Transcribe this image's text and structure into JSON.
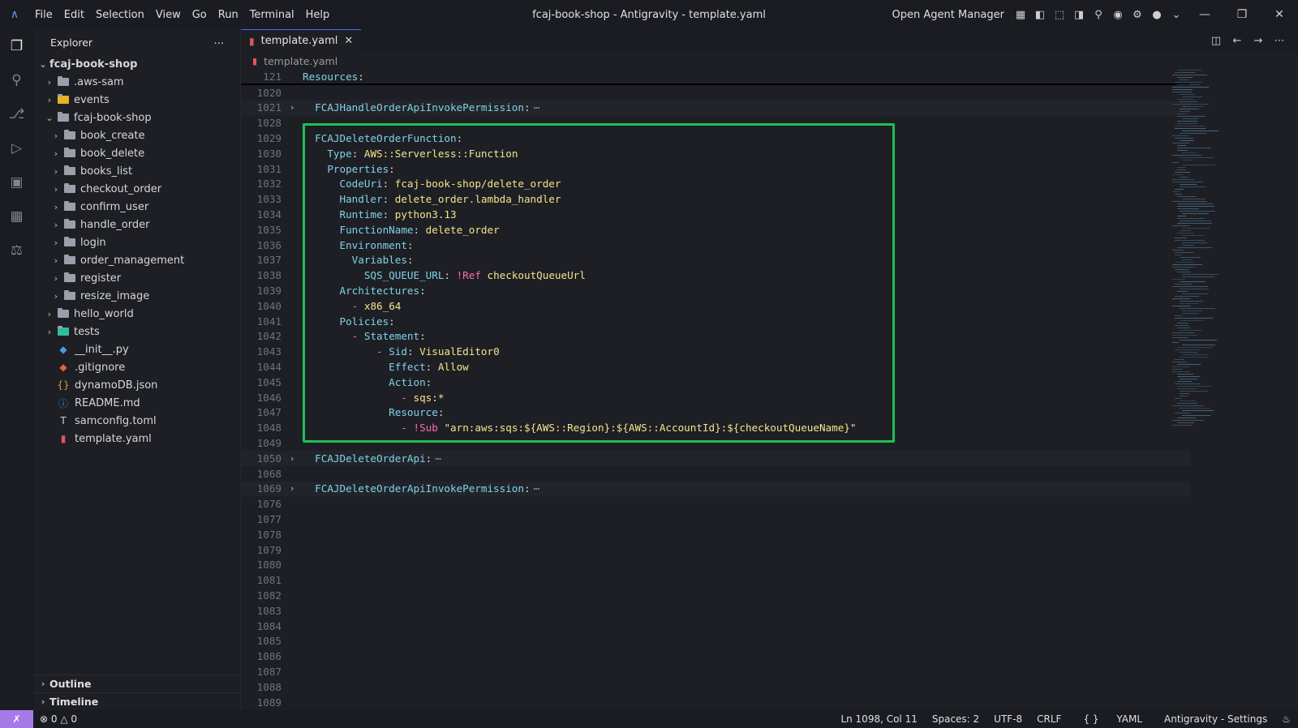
{
  "titlebar": {
    "menus": [
      "File",
      "Edit",
      "Selection",
      "View",
      "Go",
      "Run",
      "Terminal",
      "Help"
    ],
    "title": "fcaj-book-shop - Antigravity - template.yaml",
    "open_agent_manager": "Open Agent Manager"
  },
  "explorer": {
    "header": "Explorer",
    "root": "fcaj-book-shop",
    "items": [
      {
        "label": ".aws-sam",
        "depth": 1,
        "kind": "folder",
        "open": false
      },
      {
        "label": "events",
        "depth": 1,
        "kind": "folder-yellow",
        "open": false
      },
      {
        "label": "fcaj-book-shop",
        "depth": 1,
        "kind": "folder",
        "open": true
      },
      {
        "label": "book_create",
        "depth": 2,
        "kind": "folder",
        "open": false
      },
      {
        "label": "book_delete",
        "depth": 2,
        "kind": "folder",
        "open": false
      },
      {
        "label": "books_list",
        "depth": 2,
        "kind": "folder",
        "open": false
      },
      {
        "label": "checkout_order",
        "depth": 2,
        "kind": "folder",
        "open": false
      },
      {
        "label": "confirm_user",
        "depth": 2,
        "kind": "folder",
        "open": false
      },
      {
        "label": "handle_order",
        "depth": 2,
        "kind": "folder",
        "open": false
      },
      {
        "label": "login",
        "depth": 2,
        "kind": "folder",
        "open": false
      },
      {
        "label": "order_management",
        "depth": 2,
        "kind": "folder",
        "open": false
      },
      {
        "label": "register",
        "depth": 2,
        "kind": "folder",
        "open": false
      },
      {
        "label": "resize_image",
        "depth": 2,
        "kind": "folder",
        "open": false
      },
      {
        "label": "hello_world",
        "depth": 1,
        "kind": "folder",
        "open": false
      },
      {
        "label": "tests",
        "depth": 1,
        "kind": "folder-teal",
        "open": false
      },
      {
        "label": "__init__.py",
        "depth": 1,
        "kind": "python"
      },
      {
        "label": ".gitignore",
        "depth": 1,
        "kind": "git"
      },
      {
        "label": "dynamoDB.json",
        "depth": 1,
        "kind": "json"
      },
      {
        "label": "README.md",
        "depth": 1,
        "kind": "info"
      },
      {
        "label": "samconfig.toml",
        "depth": 1,
        "kind": "toml"
      },
      {
        "label": "template.yaml",
        "depth": 1,
        "kind": "yaml"
      }
    ],
    "outline": "Outline",
    "timeline": "Timeline"
  },
  "editor": {
    "tab_label": "template.yaml",
    "breadcrumb": "template.yaml",
    "lines": [
      {
        "n": "121",
        "parts": [
          [
            "k",
            "Resources"
          ],
          [
            "p",
            ":"
          ]
        ],
        "sticky": true
      },
      {
        "n": "1020",
        "parts": []
      },
      {
        "n": "1021",
        "fold": true,
        "collapsed": true,
        "parts": [
          [
            "p",
            "  "
          ],
          [
            "k",
            "FCAJHandleOrderApiInvokePermission"
          ],
          [
            "p",
            ":"
          ]
        ]
      },
      {
        "n": "1028",
        "parts": []
      },
      {
        "n": "1029",
        "parts": [
          [
            "p",
            "  "
          ],
          [
            "k",
            "FCAJDeleteOrderFunction"
          ],
          [
            "p",
            ":"
          ]
        ]
      },
      {
        "n": "1030",
        "parts": [
          [
            "p",
            "    "
          ],
          [
            "k",
            "Type"
          ],
          [
            "p",
            ": "
          ],
          [
            "v",
            "AWS::Serverless::Function"
          ]
        ]
      },
      {
        "n": "1031",
        "parts": [
          [
            "p",
            "    "
          ],
          [
            "k",
            "Properties"
          ],
          [
            "p",
            ":"
          ]
        ]
      },
      {
        "n": "1032",
        "parts": [
          [
            "p",
            "      "
          ],
          [
            "k",
            "CodeUri"
          ],
          [
            "p",
            ": "
          ],
          [
            "v",
            "fcaj-book-shop/delete_order"
          ]
        ]
      },
      {
        "n": "1033",
        "parts": [
          [
            "p",
            "      "
          ],
          [
            "k",
            "Handler"
          ],
          [
            "p",
            ": "
          ],
          [
            "v",
            "delete_order.lambda_handler"
          ]
        ]
      },
      {
        "n": "1034",
        "parts": [
          [
            "p",
            "      "
          ],
          [
            "k",
            "Runtime"
          ],
          [
            "p",
            ": "
          ],
          [
            "v",
            "python3.13"
          ]
        ]
      },
      {
        "n": "1035",
        "parts": [
          [
            "p",
            "      "
          ],
          [
            "k",
            "FunctionName"
          ],
          [
            "p",
            ": "
          ],
          [
            "v",
            "delete_order"
          ]
        ]
      },
      {
        "n": "1036",
        "parts": [
          [
            "p",
            "      "
          ],
          [
            "k",
            "Environment"
          ],
          [
            "p",
            ":"
          ]
        ]
      },
      {
        "n": "1037",
        "parts": [
          [
            "p",
            "        "
          ],
          [
            "k",
            "Variables"
          ],
          [
            "p",
            ":"
          ]
        ]
      },
      {
        "n": "1038",
        "parts": [
          [
            "p",
            "          "
          ],
          [
            "k",
            "SQS_QUEUE_URL"
          ],
          [
            "p",
            ": "
          ],
          [
            "tag",
            "!Ref"
          ],
          [
            "p",
            " "
          ],
          [
            "v",
            "checkoutQueueUrl"
          ]
        ]
      },
      {
        "n": "1039",
        "parts": [
          [
            "p",
            "      "
          ],
          [
            "k",
            "Architectures"
          ],
          [
            "p",
            ":"
          ]
        ]
      },
      {
        "n": "1040",
        "parts": [
          [
            "p",
            "        "
          ],
          [
            "dash",
            "-"
          ],
          [
            "p",
            " "
          ],
          [
            "v",
            "x86_64"
          ]
        ]
      },
      {
        "n": "1041",
        "parts": [
          [
            "p",
            "      "
          ],
          [
            "k",
            "Policies"
          ],
          [
            "p",
            ":"
          ]
        ]
      },
      {
        "n": "1042",
        "parts": [
          [
            "p",
            "        "
          ],
          [
            "dash",
            "-"
          ],
          [
            "p",
            " "
          ],
          [
            "k",
            "Statement"
          ],
          [
            "p",
            ":"
          ]
        ]
      },
      {
        "n": "1043",
        "parts": [
          [
            "p",
            "            "
          ],
          [
            "dash",
            "-"
          ],
          [
            "p",
            " "
          ],
          [
            "k",
            "Sid"
          ],
          [
            "p",
            ": "
          ],
          [
            "v",
            "VisualEditor0"
          ]
        ]
      },
      {
        "n": "1044",
        "parts": [
          [
            "p",
            "              "
          ],
          [
            "k",
            "Effect"
          ],
          [
            "p",
            ": "
          ],
          [
            "v",
            "Allow"
          ]
        ]
      },
      {
        "n": "1045",
        "parts": [
          [
            "p",
            "              "
          ],
          [
            "k",
            "Action"
          ],
          [
            "p",
            ":"
          ]
        ]
      },
      {
        "n": "1046",
        "parts": [
          [
            "p",
            "                "
          ],
          [
            "dash",
            "-"
          ],
          [
            "p",
            " "
          ],
          [
            "v",
            "sqs:*"
          ]
        ]
      },
      {
        "n": "1047",
        "parts": [
          [
            "p",
            "              "
          ],
          [
            "k",
            "Resource"
          ],
          [
            "p",
            ":"
          ]
        ]
      },
      {
        "n": "1048",
        "parts": [
          [
            "p",
            "                "
          ],
          [
            "dash",
            "-"
          ],
          [
            "p",
            " "
          ],
          [
            "tag",
            "!Sub"
          ],
          [
            "p",
            " "
          ],
          [
            "v",
            "\"arn:aws:sqs:${AWS::Region}:${AWS::AccountId}:${checkoutQueueName}\""
          ]
        ]
      },
      {
        "n": "1049",
        "parts": []
      },
      {
        "n": "1050",
        "fold": true,
        "collapsed": true,
        "parts": [
          [
            "p",
            "  "
          ],
          [
            "k",
            "FCAJDeleteOrderApi"
          ],
          [
            "p",
            ":"
          ]
        ]
      },
      {
        "n": "1068",
        "parts": []
      },
      {
        "n": "1069",
        "fold": true,
        "collapsed": true,
        "parts": [
          [
            "p",
            "  "
          ],
          [
            "k",
            "FCAJDeleteOrderApiInvokePermission"
          ],
          [
            "p",
            ":"
          ]
        ]
      },
      {
        "n": "1076",
        "parts": []
      },
      {
        "n": "1077",
        "parts": []
      },
      {
        "n": "1078",
        "parts": []
      },
      {
        "n": "1079",
        "parts": []
      },
      {
        "n": "1080",
        "parts": []
      },
      {
        "n": "1081",
        "parts": []
      },
      {
        "n": "1082",
        "parts": []
      },
      {
        "n": "1083",
        "parts": []
      },
      {
        "n": "1084",
        "parts": []
      },
      {
        "n": "1085",
        "parts": []
      },
      {
        "n": "1086",
        "parts": []
      },
      {
        "n": "1087",
        "parts": []
      },
      {
        "n": "1088",
        "parts": []
      },
      {
        "n": "1089",
        "parts": []
      }
    ]
  },
  "statusbar": {
    "errors": "0",
    "warnings": "0",
    "position": "Ln 1098, Col 11",
    "spaces": "Spaces: 2",
    "encoding": "UTF-8",
    "eol": "CRLF",
    "language": "YAML",
    "settings": "Antigravity - Settings"
  },
  "colors": {
    "highlight_border": "#1fbf56",
    "key": "#7fd3e8",
    "value": "#f2e58a",
    "tag": "#ff6ab0"
  }
}
